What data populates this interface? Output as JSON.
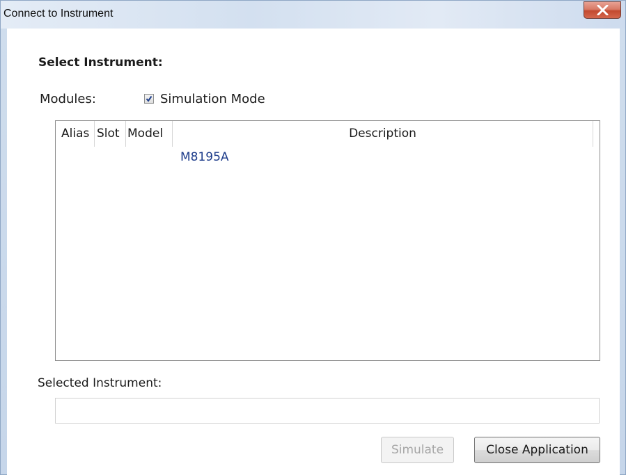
{
  "window": {
    "title": "Connect to Instrument",
    "close_icon": "close-x-icon"
  },
  "heading": "Select Instrument:",
  "modules_label": "Modules:",
  "simulation": {
    "label": "Simulation Mode",
    "checked": true
  },
  "list": {
    "columns": [
      "Alias",
      "Slot",
      "Model",
      "Description"
    ],
    "rows": [
      {
        "alias": "",
        "slot": "",
        "model": "M8195A",
        "description": ""
      }
    ]
  },
  "selected": {
    "label": "Selected Instrument:",
    "value": ""
  },
  "buttons": {
    "simulate": "Simulate",
    "close_app": "Close Application"
  },
  "colors": {
    "model_text": "#1c3b8a",
    "close_button": "#c24a30"
  }
}
